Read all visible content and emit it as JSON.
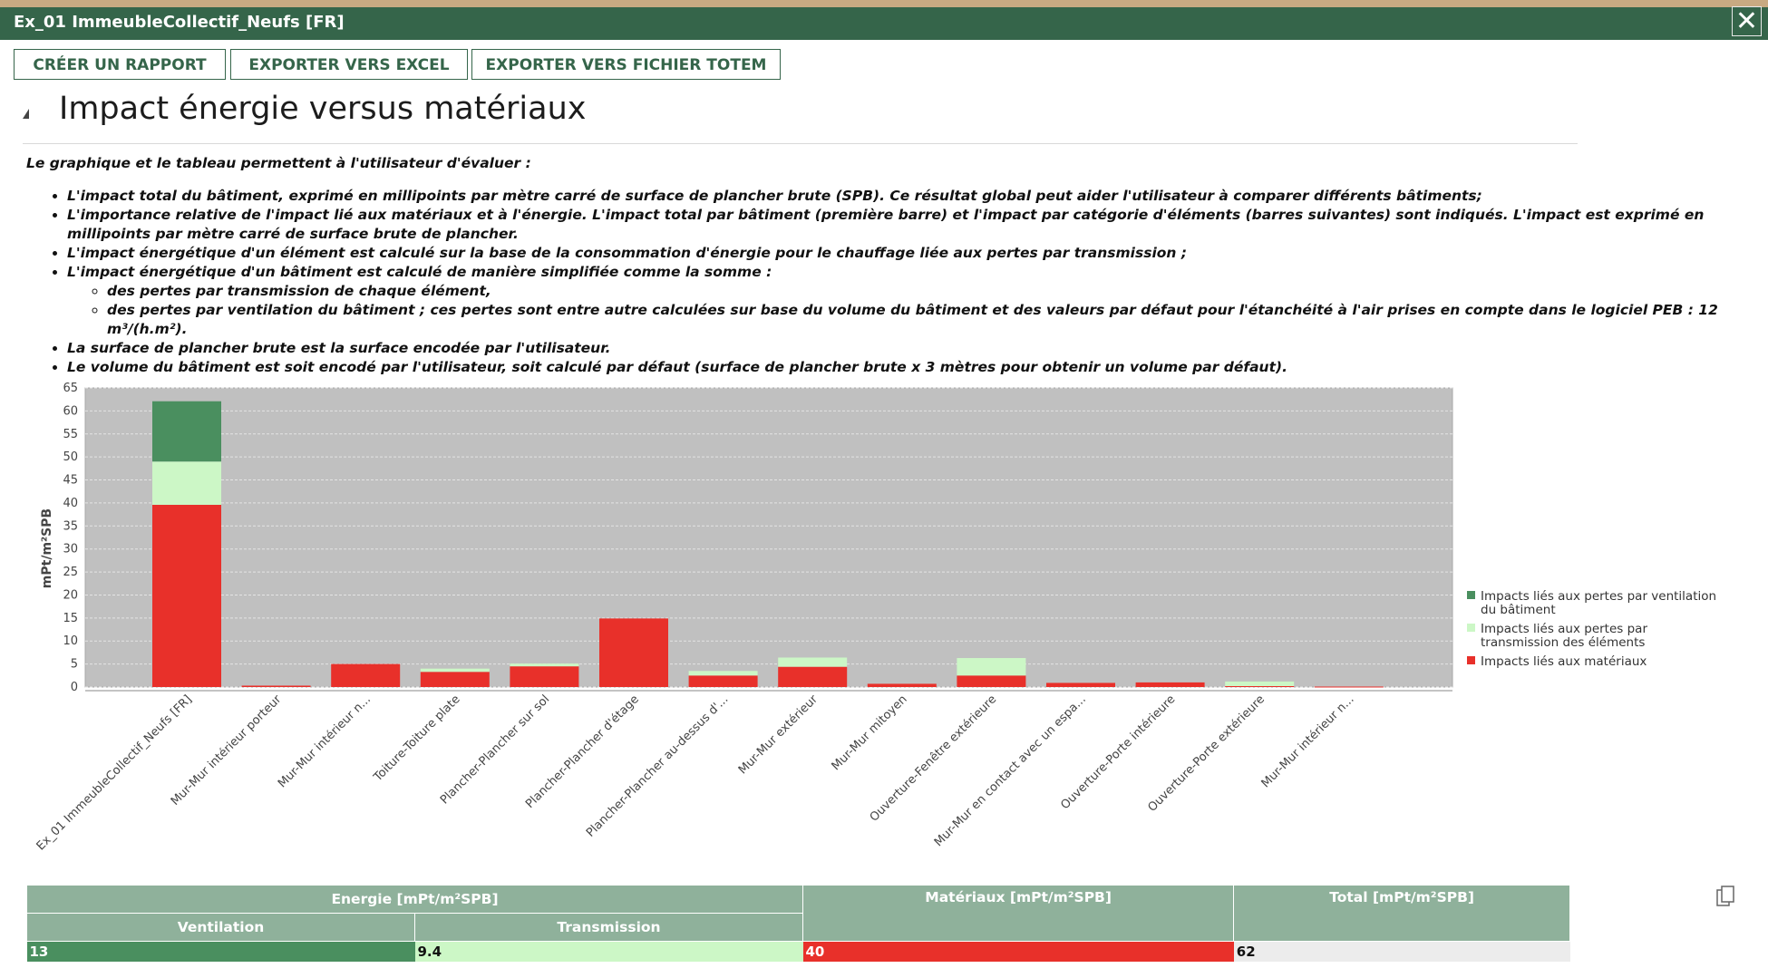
{
  "window": {
    "title": "Ex_01 ImmeubleCollectif_Neufs [FR]",
    "close_glyph": "✕"
  },
  "toolbar": {
    "report_label": "CRÉER UN RAPPORT",
    "excel_label": "EXPORTER VERS EXCEL",
    "totem_label": "EXPORTER VERS FICHIER TOTEM"
  },
  "section": {
    "title": "Impact énergie versus matériaux"
  },
  "description": {
    "intro": "Le graphique et le tableau permettent à l'utilisateur d'évaluer :",
    "b1": "L'impact total du bâtiment, exprimé en millipoints par mètre carré de surface de plancher brute (SPB). Ce résultat global peut aider l'utilisateur à comparer différents bâtiments;",
    "b2": "L'importance relative de l'impact lié aux matériaux et à l'énergie. L'impact total par bâtiment (première barre) et l'impact par catégorie d'éléments (barres suivantes) sont indiqués. L'impact est exprimé en millipoints par mètre carré de surface brute de plancher.",
    "b3": "L'impact énergétique d'un élément est calculé sur la base de la consommation d'énergie pour le chauffage liée aux pertes par transmission ;",
    "b4": "L'impact énergétique d'un bâtiment est calculé de manière simplifiée comme la somme :",
    "b4a": "des pertes par transmission de chaque élément,",
    "b4b": "des pertes par ventilation du bâtiment ; ces pertes sont entre autre calculées sur base du volume du bâtiment et des valeurs par défaut pour l'étanchéité à l'air prises en compte dans le logiciel PEB : 12 m³/(h.m²).",
    "b5": "La surface de plancher brute est la surface encodée par l'utilisateur.",
    "b6": "Le volume du bâtiment est soit encodé par l'utilisateur, soit calculé par défaut (surface de plancher brute x 3 mètres pour obtenir un volume par défaut)."
  },
  "chart_data": {
    "type": "bar",
    "stacked": true,
    "ylabel": "mPt/m²SPB",
    "ylim": [
      0,
      65
    ],
    "yticks": [
      0,
      5,
      10,
      15,
      20,
      25,
      30,
      35,
      40,
      45,
      50,
      55,
      60,
      65
    ],
    "grid": true,
    "legend_position": "right",
    "categories": [
      "Ex_01 ImmeubleCollectif_Neufs [FR]",
      "Mur-Mur intérieur porteur",
      "Mur-Mur intérieur n...",
      "Toiture-Toiture plate",
      "Plancher-Plancher sur sol",
      "Plancher-Plancher d'étage",
      "Plancher-Plancher au-dessus d'...",
      "Mur-Mur extérieur",
      "Mur-Mur mitoyen",
      "Ouverture-Fenêtre extérieure",
      "Mur-Mur en contact avec un espa...",
      "Ouverture-Porte intérieure",
      "Ouverture-Porte extérieure",
      "Mur-Mur intérieur n..."
    ],
    "series": [
      {
        "name": "Impacts liés aux matériaux",
        "color": "#e8302a",
        "values": [
          39.6,
          0.3,
          5.0,
          3.3,
          4.5,
          14.9,
          2.5,
          4.4,
          0.7,
          2.5,
          0.9,
          1.0,
          0.2,
          0.1
        ]
      },
      {
        "name": "Impacts liés aux pertes par transmission des éléments",
        "color": "#ccf7c6",
        "values": [
          9.4,
          0.0,
          0.0,
          0.7,
          0.6,
          0.0,
          1.0,
          2.0,
          0.0,
          3.8,
          0.0,
          0.0,
          1.0,
          0.0
        ]
      },
      {
        "name": "Impacts liés aux pertes par ventilation du bâtiment",
        "color": "#4a8f5f",
        "values": [
          13.1,
          0,
          0,
          0,
          0,
          0,
          0,
          0,
          0,
          0,
          0,
          0,
          0,
          0
        ]
      }
    ],
    "legend": [
      {
        "label1": "Impacts liés aux pertes par ventilation",
        "label2": "du bâtiment",
        "color": "#4a8f5f"
      },
      {
        "label1": "Impacts liés aux pertes par",
        "label2": "transmission des éléments",
        "color": "#ccf7c6"
      },
      {
        "label1": "Impacts liés aux matériaux",
        "label2": "",
        "color": "#e8302a"
      }
    ]
  },
  "summary_table": {
    "energie_header": "Energie [mPt/m²SPB]",
    "materiaux_header": "Matériaux [mPt/m²SPB]",
    "total_header": "Total [mPt/m²SPB]",
    "ventilation_header": "Ventilation",
    "transmission_header": "Transmission",
    "ventilation_value": "13",
    "transmission_value": "9.4",
    "materiaux_value": "40",
    "total_value": "62"
  },
  "colors": {
    "header_green": "#35654a",
    "table_header": "#8fb19b",
    "plot_bg": "#c0c0c0"
  }
}
